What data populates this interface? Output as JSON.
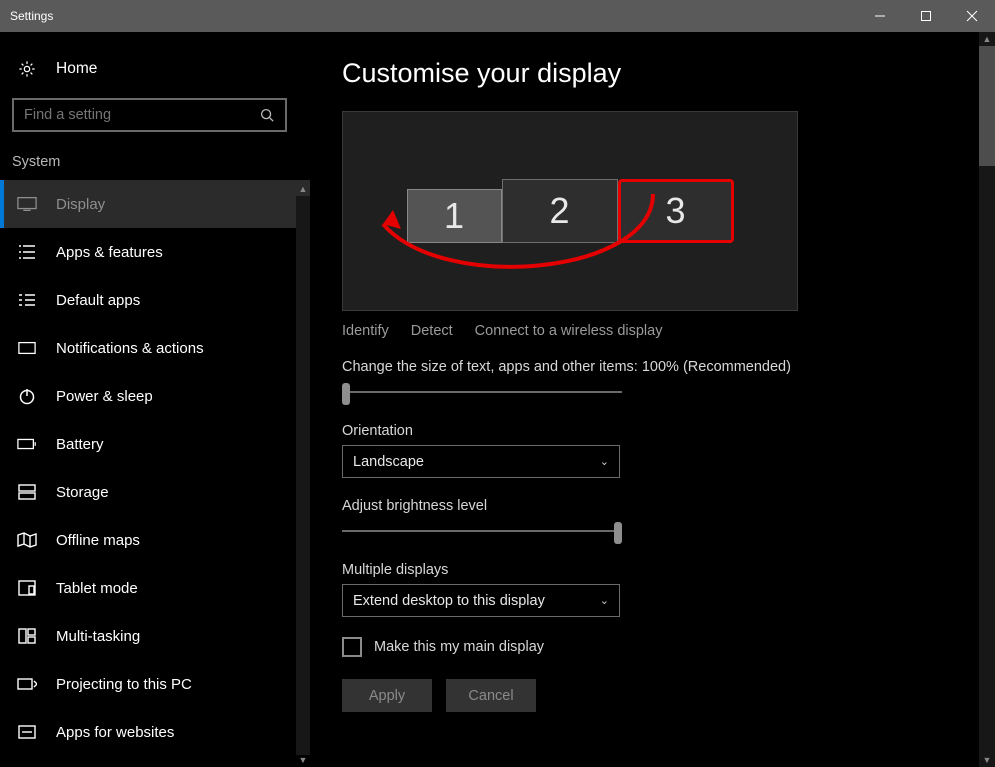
{
  "window": {
    "title": "Settings"
  },
  "sidebar": {
    "home": "Home",
    "search_placeholder": "Find a setting",
    "category": "System",
    "items": [
      {
        "label": "Display",
        "active": true
      },
      {
        "label": "Apps & features"
      },
      {
        "label": "Default apps"
      },
      {
        "label": "Notifications & actions"
      },
      {
        "label": "Power & sleep"
      },
      {
        "label": "Battery"
      },
      {
        "label": "Storage"
      },
      {
        "label": "Offline maps"
      },
      {
        "label": "Tablet mode"
      },
      {
        "label": "Multi-tasking"
      },
      {
        "label": "Projecting to this PC"
      },
      {
        "label": "Apps for websites"
      }
    ]
  },
  "main": {
    "title": "Customise your display",
    "monitors": [
      "1",
      "2",
      "3"
    ],
    "links": {
      "identify": "Identify",
      "detect": "Detect",
      "connect": "Connect to a wireless display"
    },
    "scaling_label": "Change the size of text, apps and other items: 100% (Recommended)",
    "orientation": {
      "label": "Orientation",
      "value": "Landscape"
    },
    "brightness": {
      "label": "Adjust brightness level"
    },
    "multiple": {
      "label": "Multiple displays",
      "value": "Extend desktop to this display"
    },
    "main_display_checkbox": "Make this my main display",
    "buttons": {
      "apply": "Apply",
      "cancel": "Cancel"
    }
  }
}
